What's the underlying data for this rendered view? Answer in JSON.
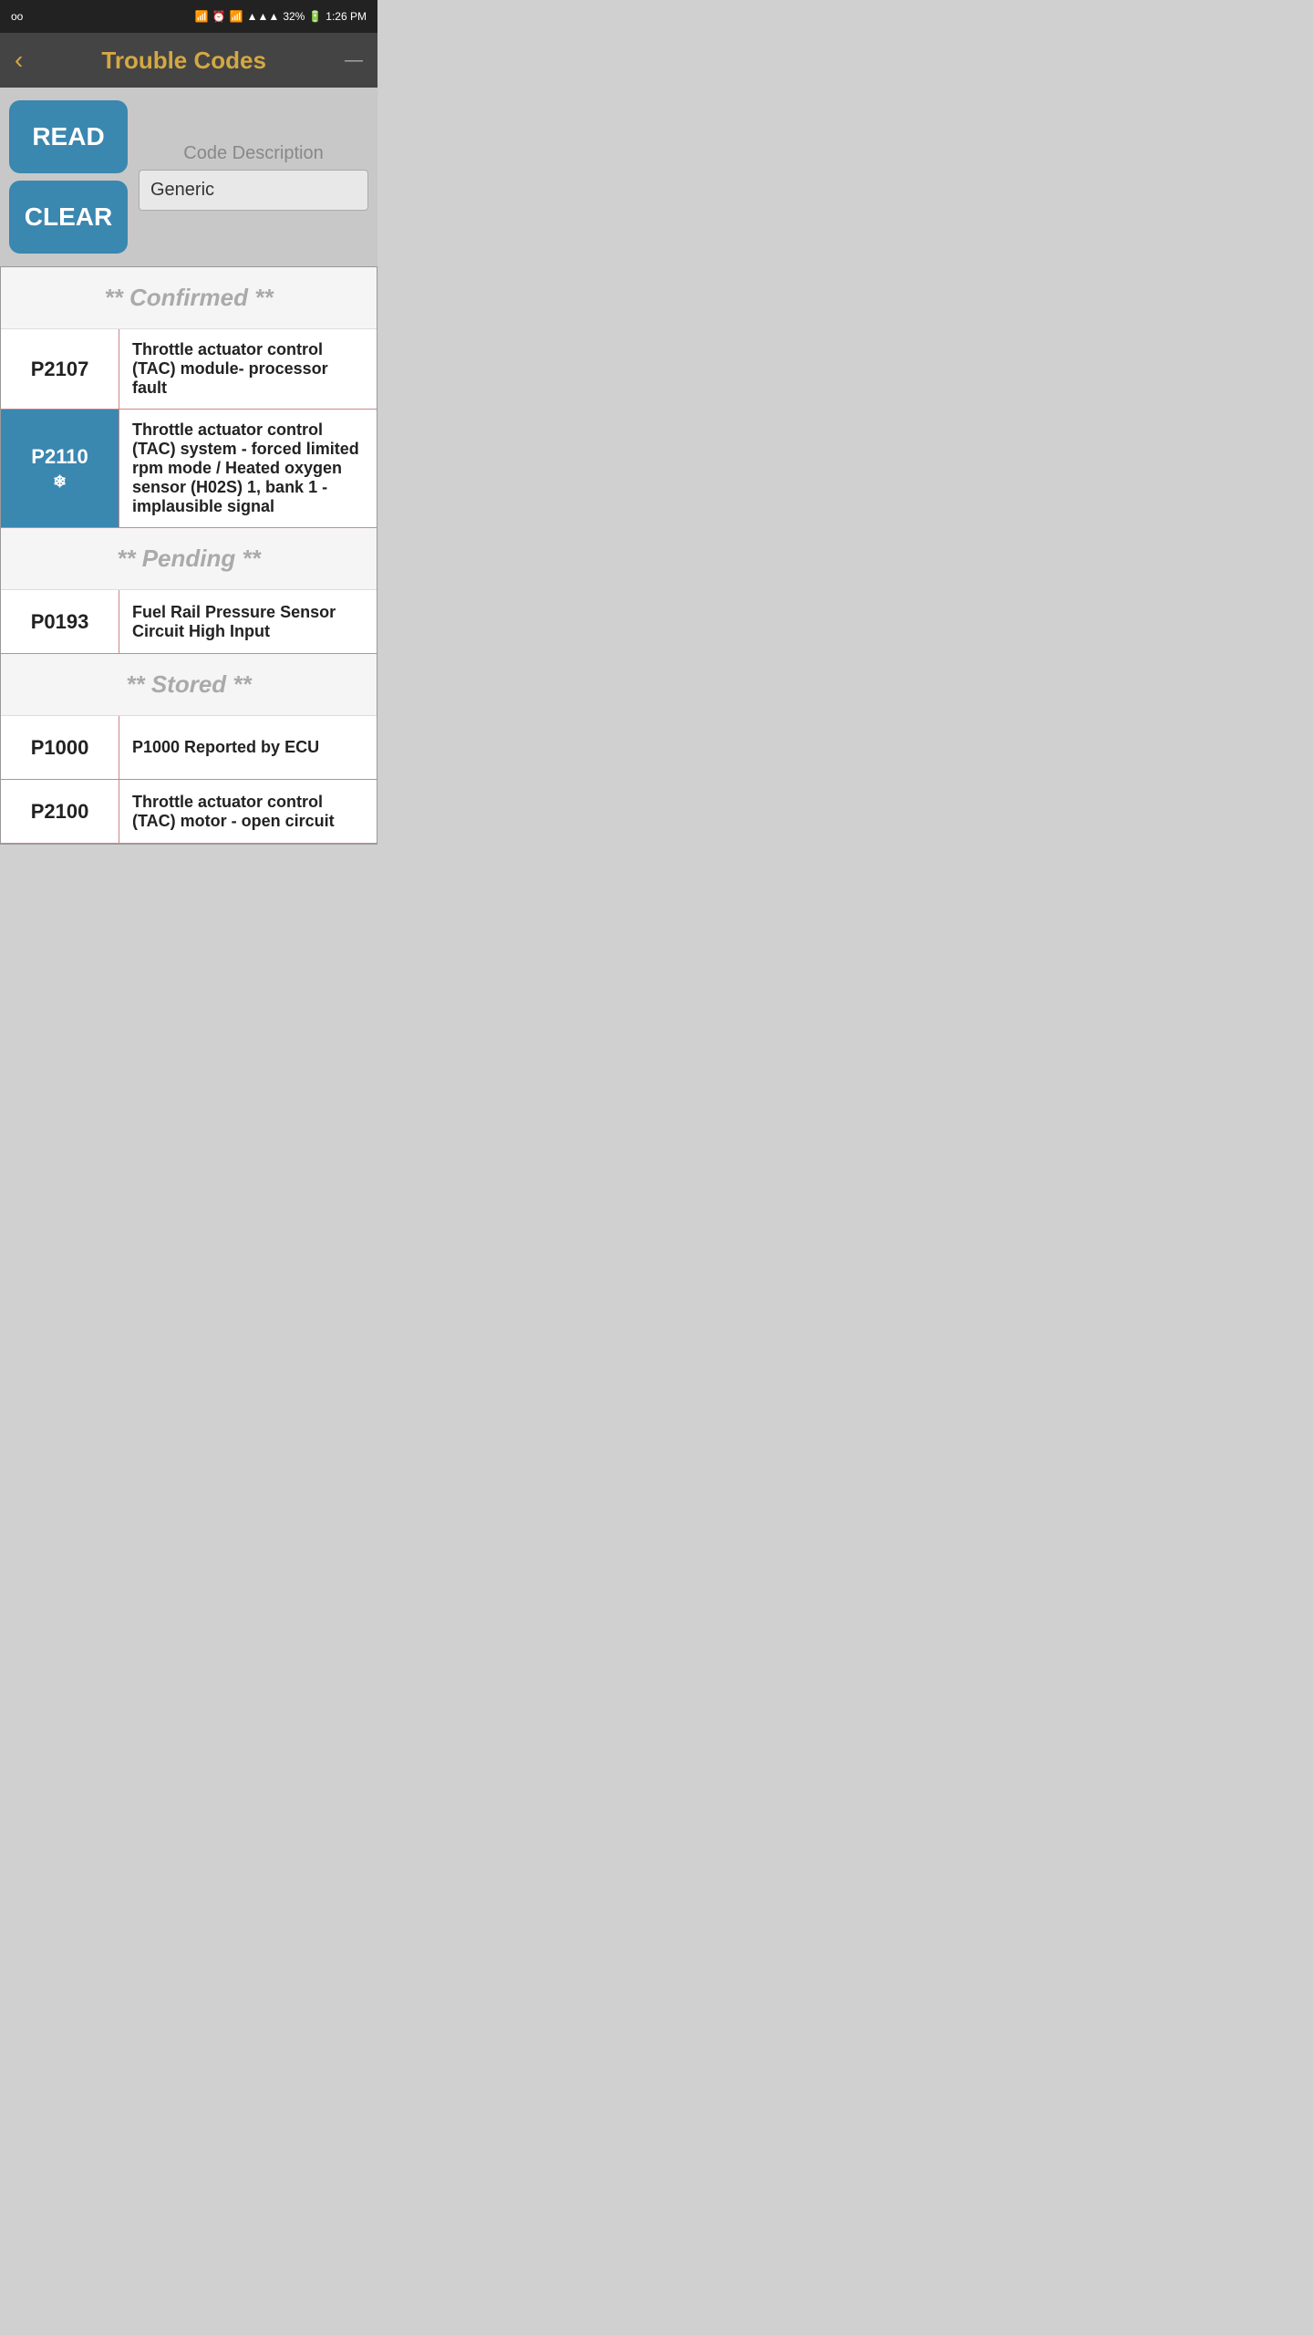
{
  "statusBar": {
    "left": "oo",
    "bluetooth": "⚡",
    "batteryPercent": "32%",
    "time": "1:26 PM"
  },
  "header": {
    "backLabel": "‹",
    "title": "Trouble Codes",
    "minimizeLabel": "—"
  },
  "controls": {
    "readLabel": "READ",
    "clearLabel": "CLEAR",
    "codeDescLabel": "Code Description",
    "codeDescValue": "Generic"
  },
  "sections": [
    {
      "id": "confirmed",
      "headerLabel": "** Confirmed **",
      "rows": [
        {
          "code": "P2107",
          "description": "Throttle actuator control (TAC) module- processor fault",
          "highlighted": false,
          "freeze": false
        },
        {
          "code": "P2110",
          "description": "Throttle actuator control (TAC) system - forced limited rpm mode / Heated oxygen sensor (H02S) 1, bank 1 - implausible signal",
          "highlighted": true,
          "freeze": true
        }
      ]
    },
    {
      "id": "pending",
      "headerLabel": "** Pending **",
      "rows": [
        {
          "code": "P0193",
          "description": "Fuel Rail Pressure Sensor Circuit High Input",
          "highlighted": false,
          "freeze": false
        }
      ]
    },
    {
      "id": "stored",
      "headerLabel": "** Stored **",
      "rows": [
        {
          "code": "P1000",
          "description": "P1000 Reported by ECU",
          "highlighted": false,
          "freeze": false
        },
        {
          "code": "P2100",
          "description": "Throttle actuator control (TAC) motor - open circuit",
          "highlighted": false,
          "freeze": false
        }
      ]
    }
  ]
}
